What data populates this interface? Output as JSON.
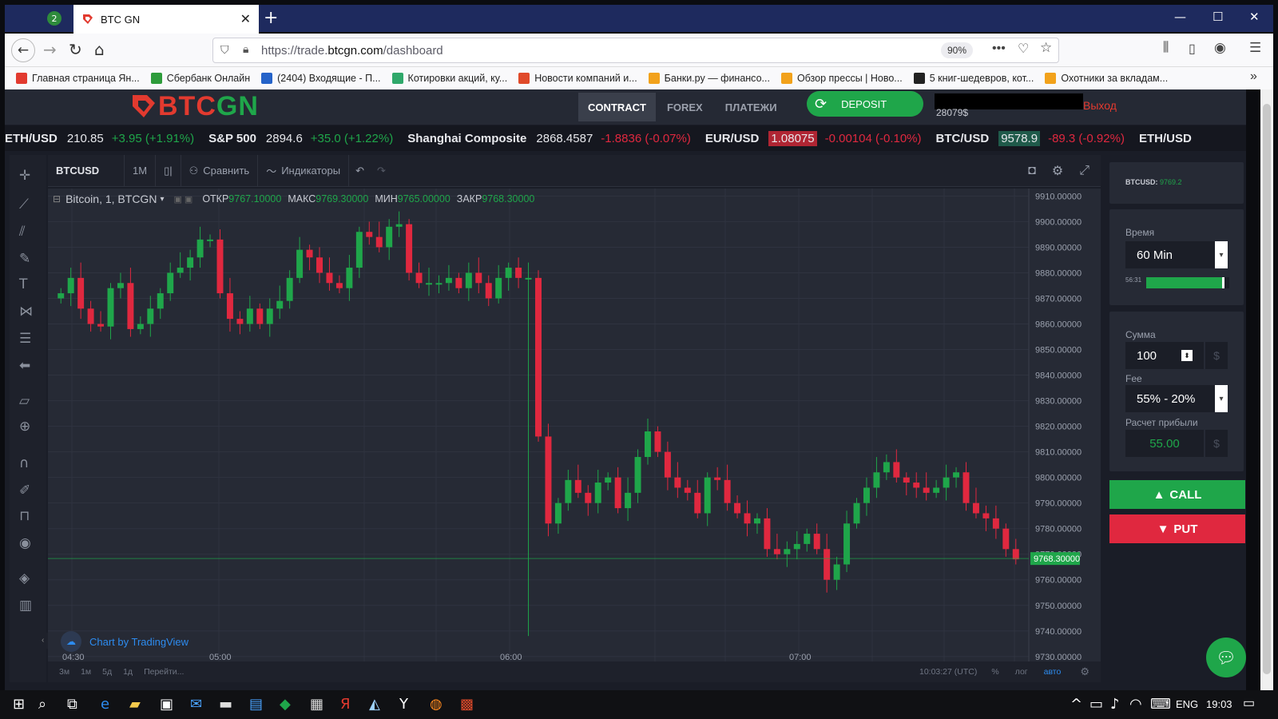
{
  "browser": {
    "tab_counter": "2",
    "tab_title": "BTC GN",
    "url_prefix": "https://trade.",
    "url_domain": "btcgn.com",
    "url_path": "/dashboard",
    "zoom": "90%",
    "bookmarks": [
      {
        "label": "Главная страница Ян...",
        "color": "#e23a2f"
      },
      {
        "label": "Сбербанк Онлайн",
        "color": "#2e9c3b"
      },
      {
        "label": "(2404) Входящие - П...",
        "color": "#2563c9"
      },
      {
        "label": "Котировки акций, ку...",
        "color": "#2fa86a"
      },
      {
        "label": "Новости компаний и...",
        "color": "#e04a2a"
      },
      {
        "label": "Банки.ру — финансо...",
        "color": "#f2a21b"
      },
      {
        "label": "Обзор прессы | Ново...",
        "color": "#f2a21b"
      },
      {
        "label": "5 книг-шедевров, кот...",
        "color": "#222222"
      },
      {
        "label": "Охотники за вкладам...",
        "color": "#f2a21b"
      }
    ]
  },
  "site": {
    "logo_a": "BTC",
    "logo_b": "GN",
    "nav": [
      "CONTRACT",
      "FOREX",
      "ПЛАТЕЖИ"
    ],
    "deposit": "DEPOSIT",
    "balance": "28079$",
    "logout": "Выход"
  },
  "ticker": [
    {
      "sym": "ETH/USD",
      "price": "210.85",
      "chg": "+3.95 (+1.91%)",
      "up": true
    },
    {
      "sym": "S&P 500",
      "price": "2894.6",
      "chg": "+35.0 (+1.22%)",
      "up": true
    },
    {
      "sym": "Shanghai Composite",
      "price": "2868.4587",
      "chg": "-1.8836 (-0.07%)",
      "up": false
    },
    {
      "sym": "EUR/USD",
      "price": "1.08075",
      "chg": "-0.00104 (-0.10%)",
      "up": false,
      "box": "#b02533"
    },
    {
      "sym": "BTC/USD",
      "price": "9578.9",
      "chg": "-89.3 (-0.92%)",
      "up": false,
      "box": "#1f5a4a"
    },
    {
      "sym": "ETH/USD",
      "price": "",
      "chg": "",
      "up": true
    }
  ],
  "chart_toolbar": {
    "symbol": "BTCUSD",
    "interval": "1M",
    "compare": "Сравнить",
    "indicators": "Индикаторы"
  },
  "legend": {
    "title": "Bitcoin, 1, BTCGN",
    "o_label": "ОТКР",
    "o": "9767.10000",
    "h_label": "МАКС",
    "h": "9769.30000",
    "l_label": "МИН",
    "l": "9765.00000",
    "c_label": "ЗАКР",
    "c": "9768.30000"
  },
  "watermark": "Chart by TradingView",
  "bottom": {
    "ranges": [
      "3м",
      "1м",
      "5д",
      "1д",
      "Перейти..."
    ],
    "clock": "10:03:27 (UTC)",
    "pct": "%",
    "log": "лог",
    "auto": "авто"
  },
  "panel": {
    "pair": "BTCUSD:",
    "pair_price": "9769.2",
    "time_label": "Время",
    "time_value": "60 Min",
    "countdown": "56:31",
    "countdown_progress": 0.94,
    "sum_label": "Сумма",
    "sum_value": "100",
    "currency": "$",
    "fee_label": "Fee",
    "fee_value": "55% - 20%",
    "profit_label": "Расчет прибыли",
    "profit_value": "55.00",
    "call": "CALL",
    "put": "PUT"
  },
  "taskbar": {
    "lang": "ENG",
    "time": "19:03"
  },
  "chart_data": {
    "type": "candlestick",
    "y_ticks": [
      "9910.00000",
      "9900.00000",
      "9890.00000",
      "9880.00000",
      "9870.00000",
      "9860.00000",
      "9850.00000",
      "9840.00000",
      "9830.00000",
      "9820.00000",
      "9810.00000",
      "9800.00000",
      "9790.00000",
      "9780.00000",
      "9770.00000",
      "9760.00000",
      "9750.00000",
      "9740.00000",
      "9730.00000"
    ],
    "ylim": [
      9729,
      9912
    ],
    "x_ticks": [
      "04:30",
      "05:00",
      "06:00",
      "07:00"
    ],
    "last_price_label": "9768.30000",
    "last_price": 9768.3,
    "closes": [
      9872,
      9878,
      9866,
      9860,
      9859,
      9874,
      9876,
      9858,
      9860,
      9866,
      9872,
      9880,
      9882,
      9886,
      9893,
      9893,
      9872,
      9862,
      9860,
      9866,
      9860,
      9866,
      9869,
      9878,
      9889,
      9886,
      9880,
      9876,
      9874,
      9882,
      9896,
      9894,
      9890,
      9898,
      9899,
      9880,
      9876,
      9876,
      9876,
      9878,
      9874,
      9880,
      9876,
      9870,
      9878,
      9882,
      9878,
      9878,
      9816,
      9782,
      9790,
      9799,
      9794,
      9790,
      9798,
      9800,
      9788,
      9794,
      9808,
      9818,
      9810,
      9800,
      9796,
      9794,
      9786,
      9800,
      9799,
      9790,
      9786,
      9782,
      9784,
      9772,
      9770,
      9772,
      9774,
      9778,
      9772,
      9760,
      9766,
      9782,
      9790,
      9796,
      9802,
      9806,
      9800,
      9798,
      9796,
      9794,
      9796,
      9800,
      9802,
      9790,
      9786,
      9784,
      9780,
      9772,
      9768
    ]
  }
}
